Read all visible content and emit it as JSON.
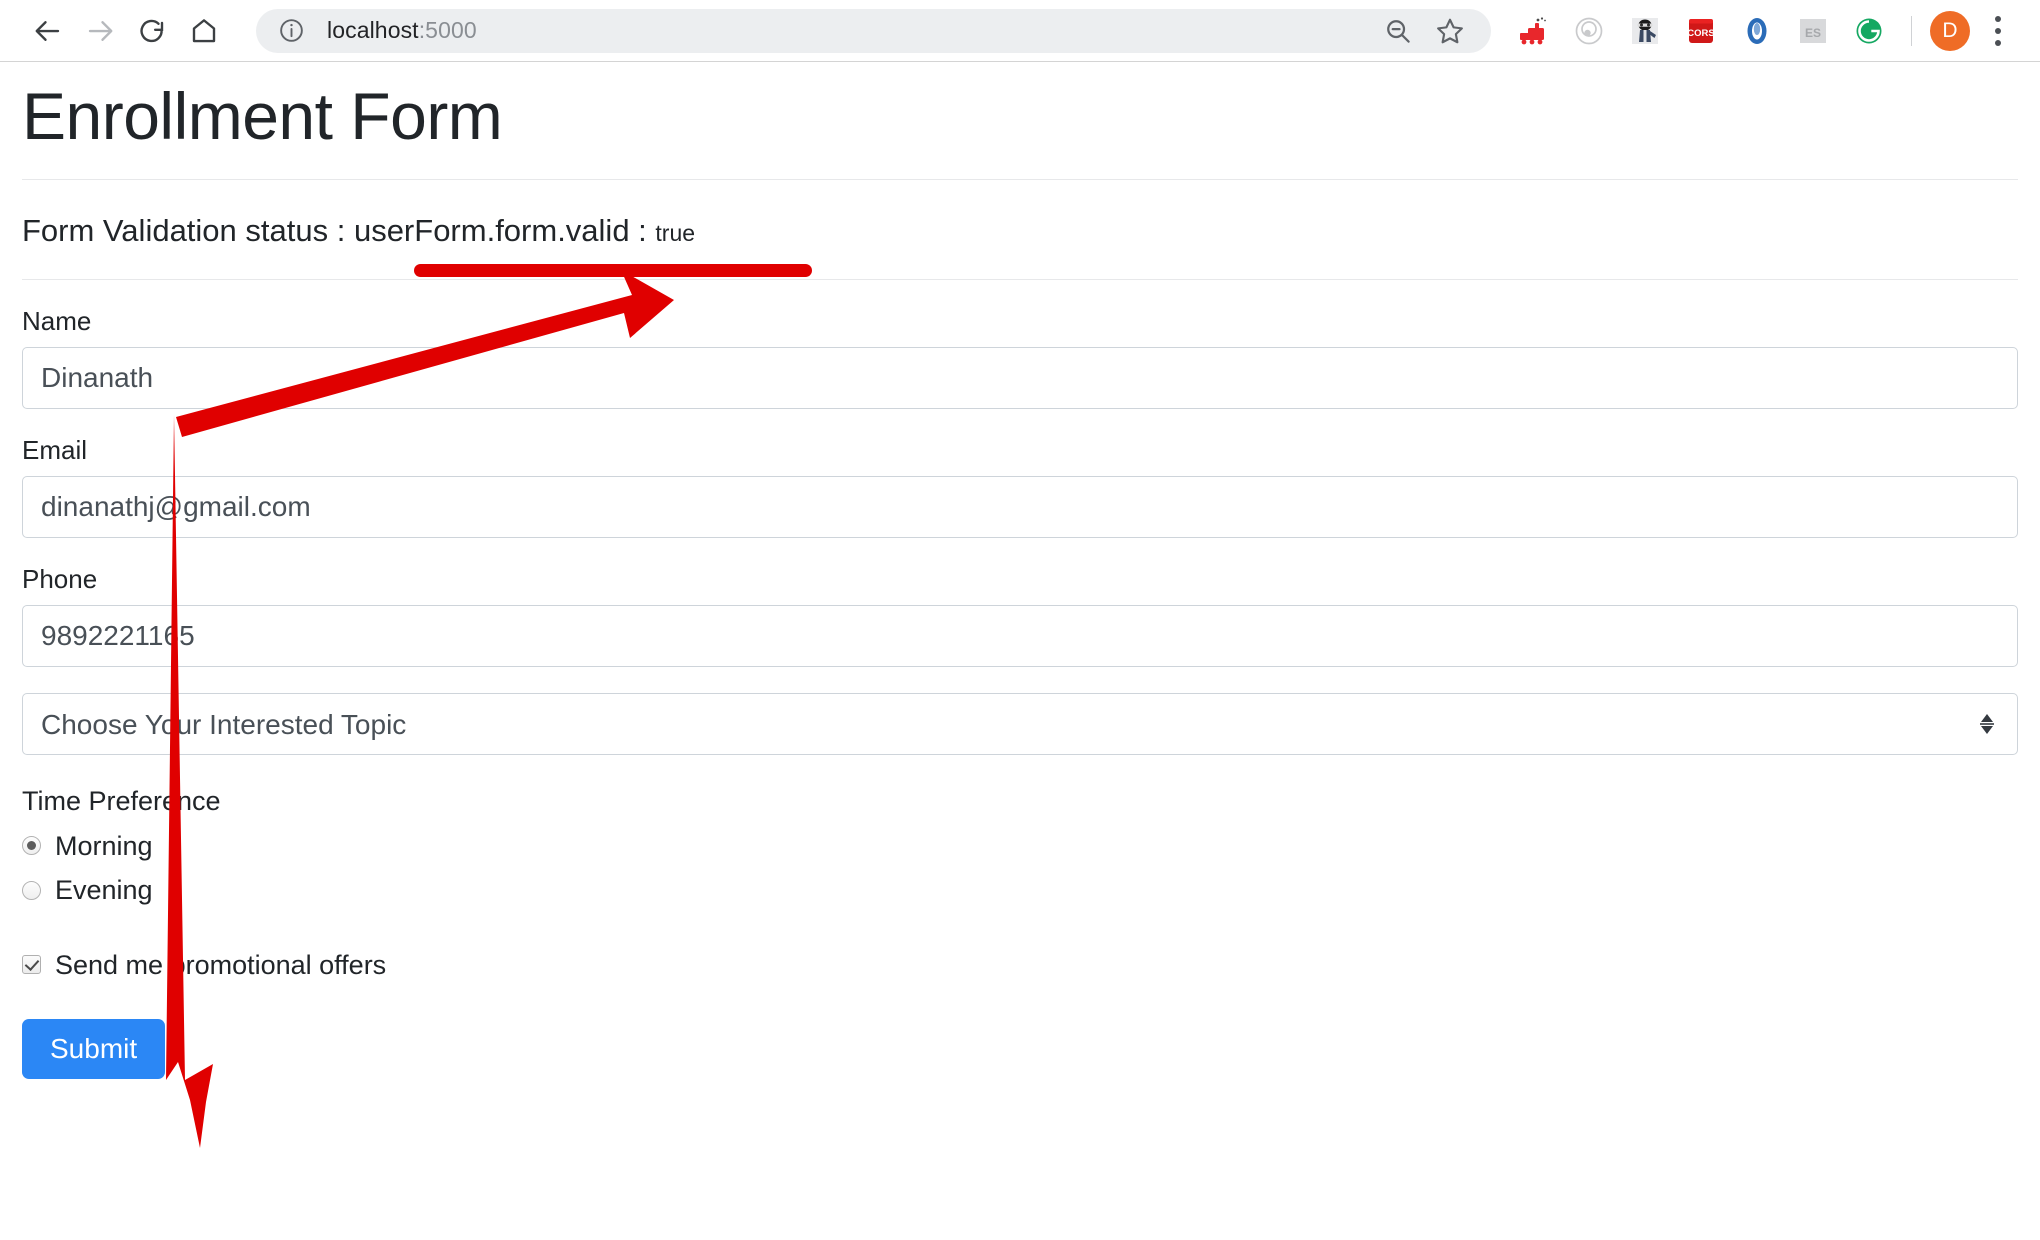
{
  "browser": {
    "url_host": "localhost",
    "url_port": ":5000",
    "back_icon": "back-arrow-icon",
    "forward_icon": "forward-arrow-icon",
    "reload_icon": "reload-icon",
    "home_icon": "home-icon",
    "site_info_icon": "site-info-icon",
    "zoom_out_icon": "zoom-out-icon",
    "bookmark_icon": "star-icon",
    "profile_initial": "D",
    "menu_icon": "three-dot-menu-icon",
    "extensions": [
      {
        "name": "red-train-extension-icon",
        "label": ""
      },
      {
        "name": "atom-orbit-extension-icon",
        "label": ""
      },
      {
        "name": "octocat-extension-icon",
        "label": ""
      },
      {
        "name": "cors-extension-icon",
        "label": "CORS"
      },
      {
        "name": "blue-droplet-extension-icon",
        "label": ""
      },
      {
        "name": "es-extension-icon",
        "label": "ES"
      },
      {
        "name": "grammarly-extension-icon",
        "label": "G"
      }
    ]
  },
  "page": {
    "title": "Enrollment Form",
    "status_prefix": "Form Validation status : userForm.form.valid : ",
    "status_value": "true"
  },
  "form": {
    "name": {
      "label": "Name",
      "value": "Dinanath",
      "placeholder": ""
    },
    "email": {
      "label": "Email",
      "value": "dinanathj@gmail.com",
      "placeholder": ""
    },
    "phone": {
      "label": "Phone",
      "value": "9892221165",
      "placeholder": ""
    },
    "topic": {
      "selected": "Choose Your Interested Topic",
      "options": [
        "Choose Your Interested Topic"
      ]
    },
    "time_preference": {
      "label": "Time Preference",
      "options": [
        {
          "label": "Morning",
          "checked": true
        },
        {
          "label": "Evening",
          "checked": false
        }
      ]
    },
    "promotional": {
      "label": "Send me promotional offers",
      "checked": true
    },
    "submit_label": "Submit"
  },
  "annotations": {
    "accent_color": "#e00000",
    "underline_target": "form-validation-status-value",
    "arrow_diagonal": "points-up-right-to-validation-status",
    "arrow_vertical": "points-down-to-submit-button"
  },
  "colors": {
    "primary_button": "#2b87f5",
    "avatar": "#ef6c26",
    "annotation_red": "#e00000",
    "input_border": "#ced4da",
    "text": "#212529"
  }
}
